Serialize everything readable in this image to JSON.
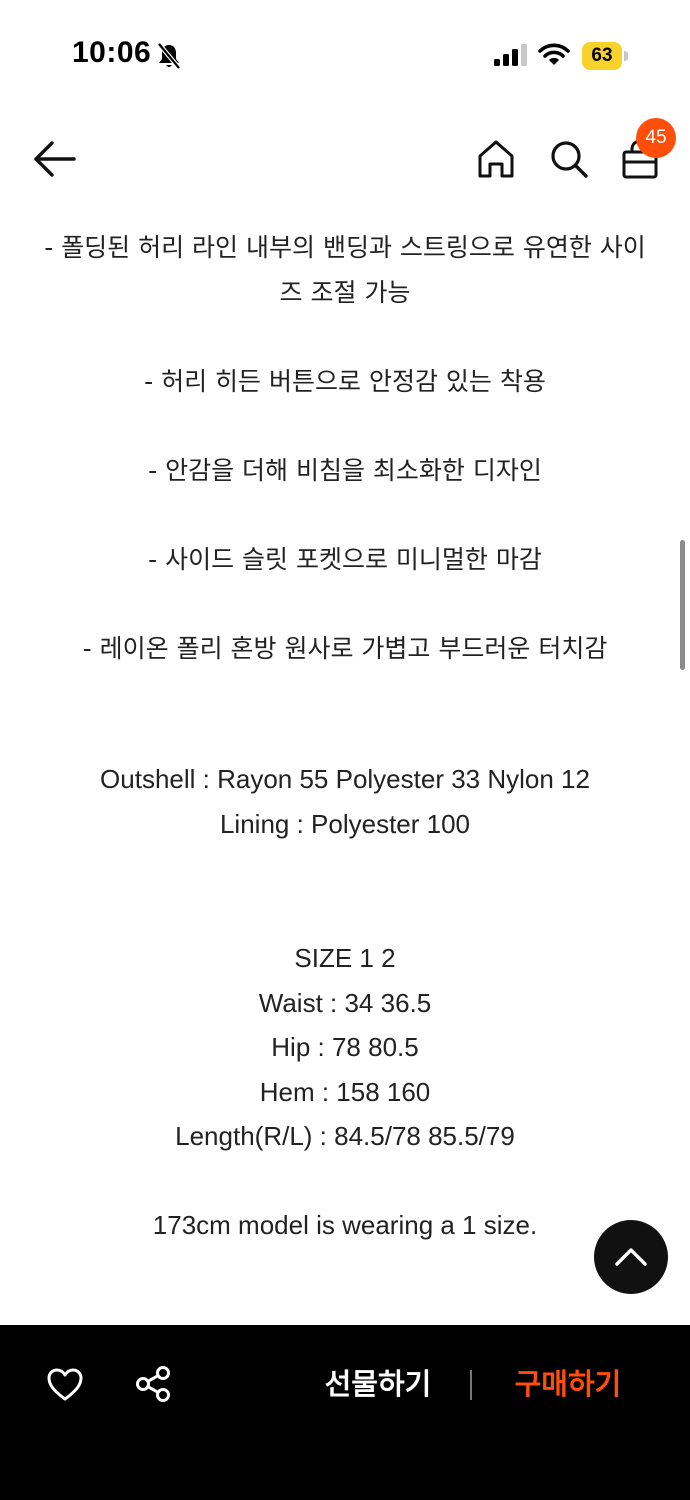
{
  "status_bar": {
    "time": "10:06",
    "battery_level": "63",
    "battery_color": "#f6d22a",
    "icons": [
      "bell-slash-icon",
      "signal-icon",
      "wifi-icon",
      "battery-icon"
    ]
  },
  "nav": {
    "icons": [
      "back-arrow-icon",
      "home-icon",
      "search-icon",
      "shopping-bag-icon"
    ],
    "cart_count": "45",
    "badge_color": "#ff4d0a"
  },
  "content": {
    "lines": [
      "- 폴딩된 허리 라인 내부의 밴딩과 스트링으로 유연한 사이",
      "즈 조절 가능",
      "- 허리 히든 버튼으로 안정감 있는 착용",
      "- 안감을 더해 비침을 최소화한 디자인",
      "- 사이드 슬릿 포켓으로 미니멀한 마감",
      "- 레이온 폴리 혼방 원사로 가볍고 부드러운 터치감",
      "Outshell : Rayon 55 Polyester 33 Nylon 12",
      "Lining : Polyester 100",
      "SIZE 1 2",
      "Waist : 34 36.5",
      "Hip : 78 80.5",
      "Hem : 158 160",
      "Length(R/L) : 84.5/78 85.5/79",
      "173cm model is wearing a 1 size."
    ]
  },
  "bottom_bar": {
    "gift_label": "선물하기",
    "buy_label": "구매하기",
    "buy_color": "#ff4d0a",
    "icons": [
      "heart-icon",
      "share-icon"
    ]
  },
  "scroll_top": {
    "icon": "chevron-up-icon"
  }
}
